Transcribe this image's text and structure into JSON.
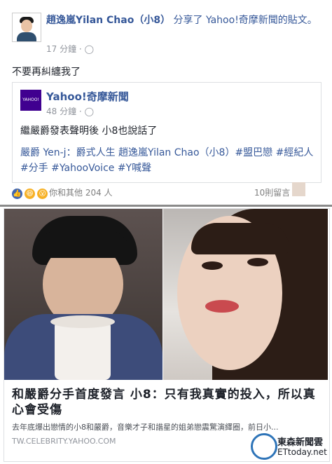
{
  "post": {
    "author": "趙逸嵐Yilan Chao（小8）",
    "shared_text": "分享了 Yahoo!奇摩新聞的貼文。",
    "time": "17 分鐘",
    "status": "不要再糾纏我了",
    "globe": "·"
  },
  "shared_card": {
    "page_name": "Yahoo!奇摩新聞",
    "time": "48 分鐘",
    "text": "繼嚴爵發表聲明後 小8也說話了",
    "tags": "嚴爵 Yen-j：爵式人生 趙逸嵐Yilan Chao（小8）#盟巴戀 #經紀人 #分手 #YahooVoice #Y喊聲",
    "logo": "YAHOO! 新聞"
  },
  "reactions": {
    "text": "你和其他 204 人",
    "comments": "10則留言"
  },
  "link": {
    "title": "和嚴爵分手首度發言 小8：只有我真實的投入，所以真心會受傷",
    "subtitle": "去年底爆出戀情的小8和嚴爵，音樂才子和諧星的姐弟戀震驚演繹圈，前日小...",
    "domain": "TW.CELEBRITY.YAHOO.COM"
  },
  "watermark": {
    "line1": "東森新聞雲",
    "line2": "ETtoday.net"
  },
  "colors": {
    "facebook_link": "#365899",
    "yahoo_purple": "#400090",
    "ettoday_blue": "#2e74b8"
  }
}
